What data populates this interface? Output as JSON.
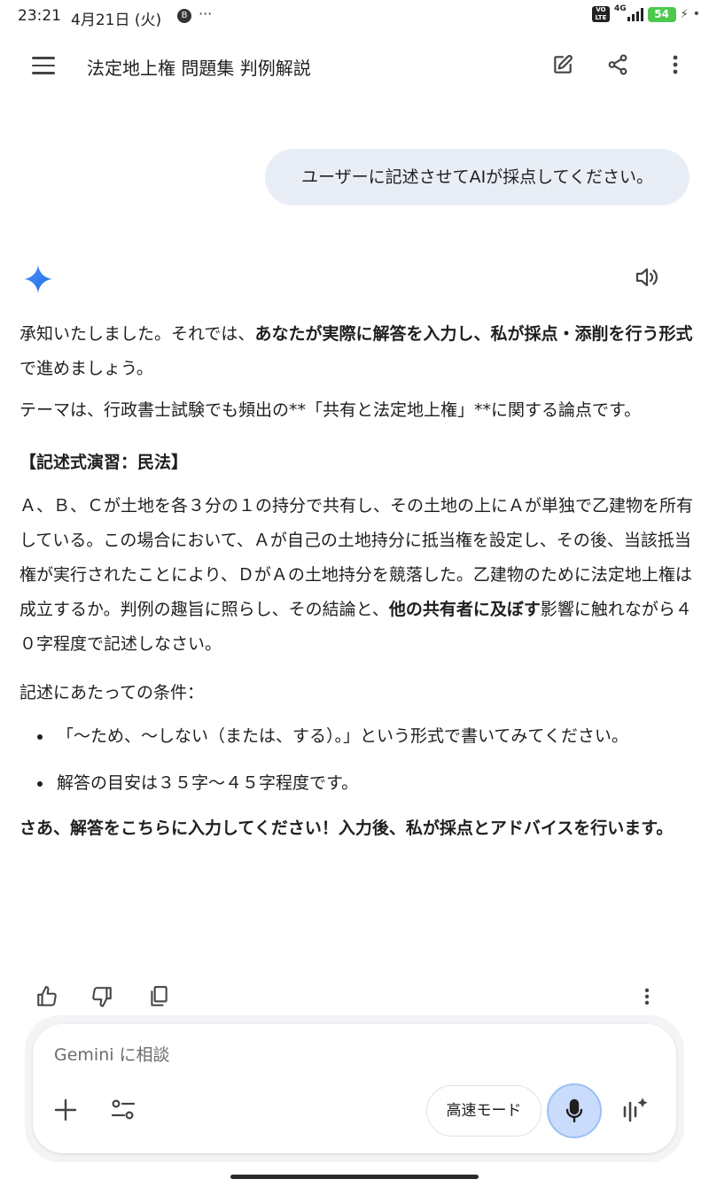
{
  "status_bar": {
    "time": "23:21",
    "date": "4月21日 (火)",
    "badge": "B",
    "more": "···",
    "network_type": "4G",
    "battery": "54"
  },
  "app_bar": {
    "title": "法定地上権 問題集 判例解説"
  },
  "user_message": "ユーザーに記述させてAIが採点してください。",
  "response": {
    "p1_a": "承知いたしました。それでは、",
    "p1_b": "あなたが実際に解答を入力し、私が採点・添削を行う形式",
    "p1_c": "で進めましょう。",
    "p2": "テーマは、行政書士試験でも頻出の**「共有と法定地上権」**に関する論点です。",
    "section_title": "【記述式演習：民法】",
    "p3_a": "Ａ、Ｂ、Ｃが土地を各３分の１の持分で共有し、その土地の上にＡが単独で乙建物を所有している。この場合において、Ａが自己の土地持分に抵当権を設定し、その後、当該抵当権が実行されたことにより、ＤがＡの土地持分を競落した。乙建物のために法定地上権は成立するか。判例の趣旨に照らし、その結論と、",
    "p3_b": "他の共有者に及ぼす",
    "p3_c": "影響に触れながら４０字程度で記述しなさい。",
    "p4": "記述にあたっての条件：",
    "bullets": [
      "「〜ため、〜しない（または、する）。」という形式で書いてみてください。",
      "解答の目安は３５字〜４５字程度です。"
    ],
    "p5": "さあ、解答をこちらに入力してください！入力後、私が採点とアドバイスを行います。"
  },
  "composer": {
    "placeholder": "Gemini に相談",
    "value": "",
    "mode_label": "高速モード"
  },
  "colors": {
    "bubble": "#e9eef6",
    "mic_bg": "#c9dcfb",
    "gemini_blue": "#4285f4",
    "battery": "#4cc94c"
  },
  "icons": [
    "menu-icon",
    "edit-icon",
    "share-icon",
    "more-vert-icon",
    "gemini-sparkle-icon",
    "speaker-icon",
    "thumb-up-icon",
    "thumb-down-icon",
    "copy-icon",
    "plus-icon",
    "tools-icon",
    "mic-icon",
    "live-icon"
  ]
}
